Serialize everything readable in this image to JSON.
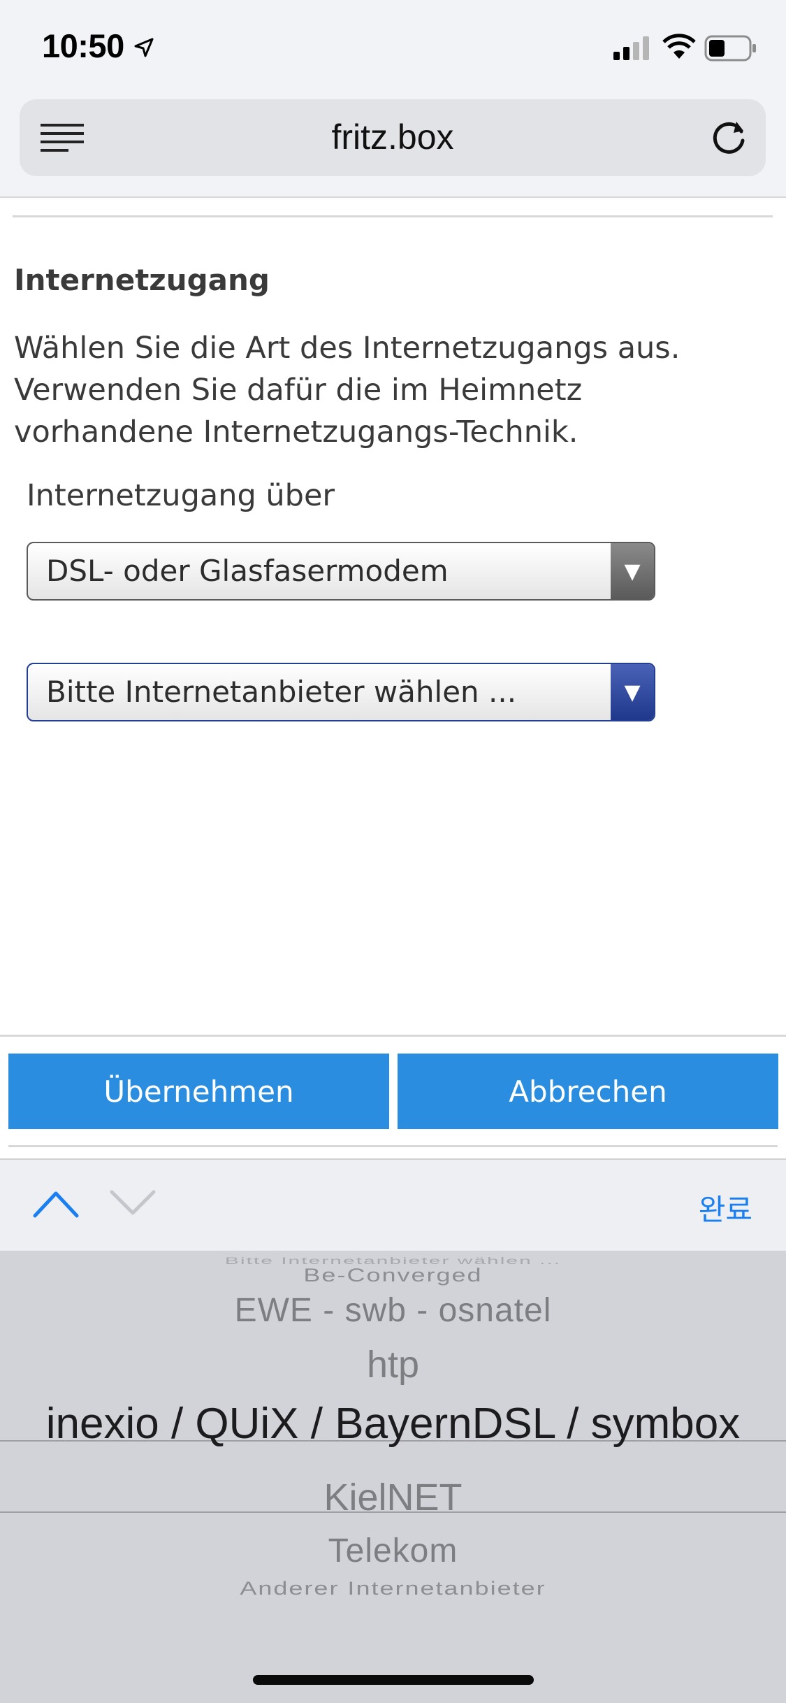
{
  "status_bar": {
    "time": "10:50",
    "icons": [
      "location-arrow-icon",
      "cellular-signal-icon",
      "wifi-icon",
      "battery-icon"
    ]
  },
  "browser": {
    "url": "fritz.box",
    "icons": [
      "reader-menu-icon",
      "reload-icon"
    ]
  },
  "page": {
    "section_title": "Internetzugang",
    "description": "Wählen Sie die Art des Internetzugangs aus. Verwenden Sie dafür die im Heimnetz vorhandene Internetzugangs-Technik.",
    "access_label": "Internetzugang über",
    "access_select_value": "DSL- oder Glasfasermodem",
    "provider_select_value": "Bitte Internetanbieter wählen ...",
    "buttons": {
      "apply": "Übernehmen",
      "cancel": "Abbrechen"
    }
  },
  "keyboard_bar": {
    "done_label": "완료",
    "icons": [
      "chevron-up-icon",
      "chevron-down-icon"
    ]
  },
  "picker": {
    "items": [
      "Bitte Internetanbieter wählen ...",
      "Be-Converged",
      "EWE - swb - osnatel",
      "htp",
      "inexio / QUiX / BayernDSL / symbox",
      "KielNET",
      "Telekom",
      "Anderer Internetanbieter"
    ],
    "selected_index": 4
  },
  "colors": {
    "accent_button": "#2a8de0",
    "ios_blue": "#1a7ff0",
    "provider_select_border": "#233f93"
  }
}
